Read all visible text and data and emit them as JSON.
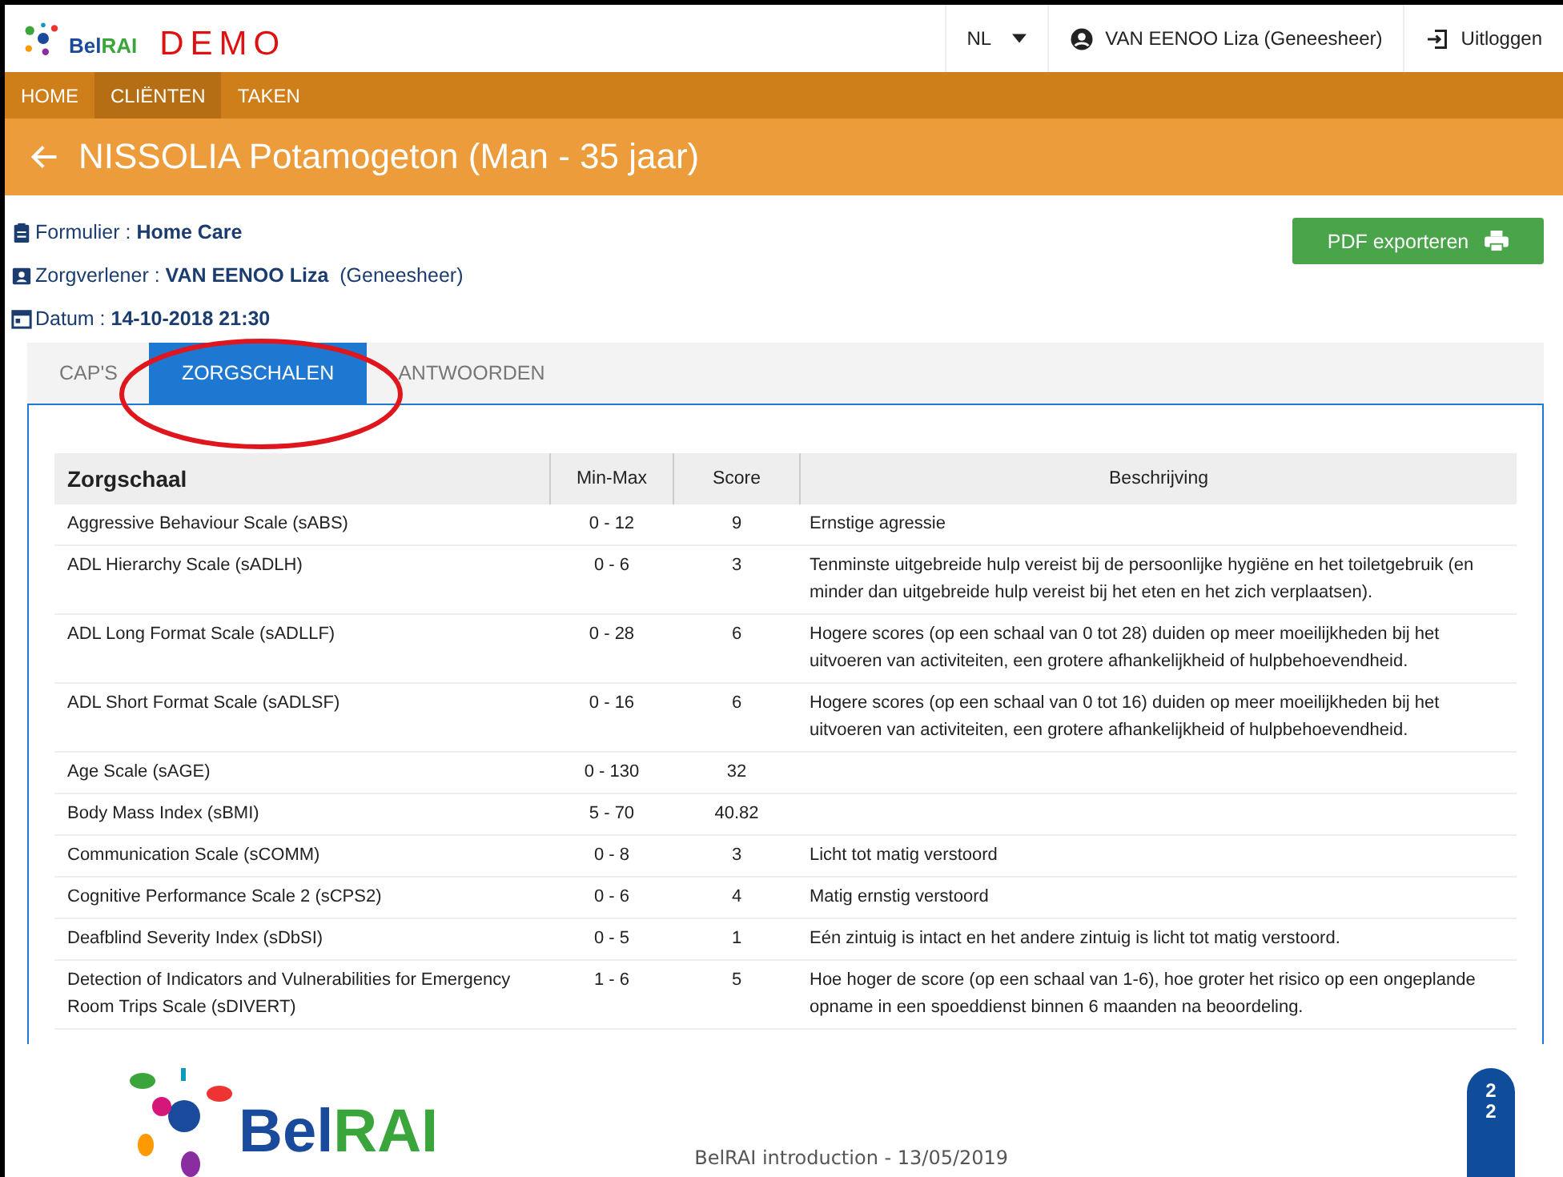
{
  "header": {
    "brand": {
      "first": "Bel",
      "second": "RAI"
    },
    "env_label": "DEMO",
    "language": "NL",
    "user": "VAN EENOO Liza (Geneesheer)",
    "logout": "Uitloggen"
  },
  "nav": [
    {
      "label": "HOME",
      "selected": false
    },
    {
      "label": "CLIËNTEN",
      "selected": true
    },
    {
      "label": "TAKEN",
      "selected": false
    }
  ],
  "page_title": "NISSOLIA Potamogeton (Man - 35 jaar)",
  "info": [
    {
      "kind": "form",
      "label": "Formulier : ",
      "value": "Home Care"
    },
    {
      "kind": "provider",
      "label": "Zorgverlener : ",
      "value": "VAN EENOO Liza",
      "extra": "(Geneesheer)"
    },
    {
      "kind": "date",
      "label": "Datum : ",
      "value": "14-10-2018 21:30"
    }
  ],
  "export_button": "PDF exporteren",
  "tabs": [
    {
      "label": "CAP'S",
      "selected": false
    },
    {
      "label": "ZORGSCHALEN",
      "selected": true
    },
    {
      "label": "ANTWOORDEN",
      "selected": false
    }
  ],
  "table": {
    "columns": [
      "Zorgschaal",
      "Min-Max",
      "Score",
      "Beschrijving"
    ],
    "rows": [
      [
        "Aggressive Behaviour Scale (sABS)",
        "0 - 12",
        "9",
        "Ernstige agressie"
      ],
      [
        "ADL Hierarchy Scale (sADLH)",
        "0 - 6",
        "3",
        "Tenminste uitgebreide hulp vereist bij de persoonlijke hygiëne en het toiletgebruik (en minder dan uitgebreide hulp vereist bij het eten en het zich verplaatsen)."
      ],
      [
        "ADL Long Format Scale (sADLLF)",
        "0 - 28",
        "6",
        "Hogere scores (op een schaal van 0 tot 28) duiden op meer moeilijkheden bij het uitvoeren van activiteiten, een grotere afhankelijkheid of hulpbehoevendheid."
      ],
      [
        "ADL Short Format Scale (sADLSF)",
        "0 - 16",
        "6",
        "Hogere scores (op een schaal van 0 tot 16) duiden op meer moeilijkheden bij het uitvoeren van activiteiten, een grotere afhankelijkheid of hulpbehoevendheid."
      ],
      [
        "Age Scale (sAGE)",
        "0 - 130",
        "32",
        ""
      ],
      [
        "Body Mass Index (sBMI)",
        "5 - 70",
        "40.82",
        ""
      ],
      [
        "Communication Scale (sCOMM)",
        "0 - 8",
        "3",
        "Licht tot matig verstoord"
      ],
      [
        "Cognitive Performance Scale 2 (sCPS2)",
        "0 - 6",
        "4",
        "Matig ernstig verstoord"
      ],
      [
        "Deafblind Severity Index (sDbSI)",
        "0 - 5",
        "1",
        "Eén zintuig is intact en het andere zintuig is licht tot matig verstoord."
      ],
      [
        "Detection of Indicators and Vulnerabilities for Emergency Room Trips Scale (sDIVERT)",
        "1 - 6",
        "5",
        "Hoe hoger de score (op een schaal van 1-6), hoe groter het risico op een ongeplande opname in een spoeddienst binnen 6 maanden na beoordeling."
      ]
    ]
  },
  "slide_footer": {
    "brand": {
      "first": "Bel",
      "second": "RAI"
    },
    "caption": "BelRAI introduction - 13/05/2019",
    "page_number": "22"
  }
}
